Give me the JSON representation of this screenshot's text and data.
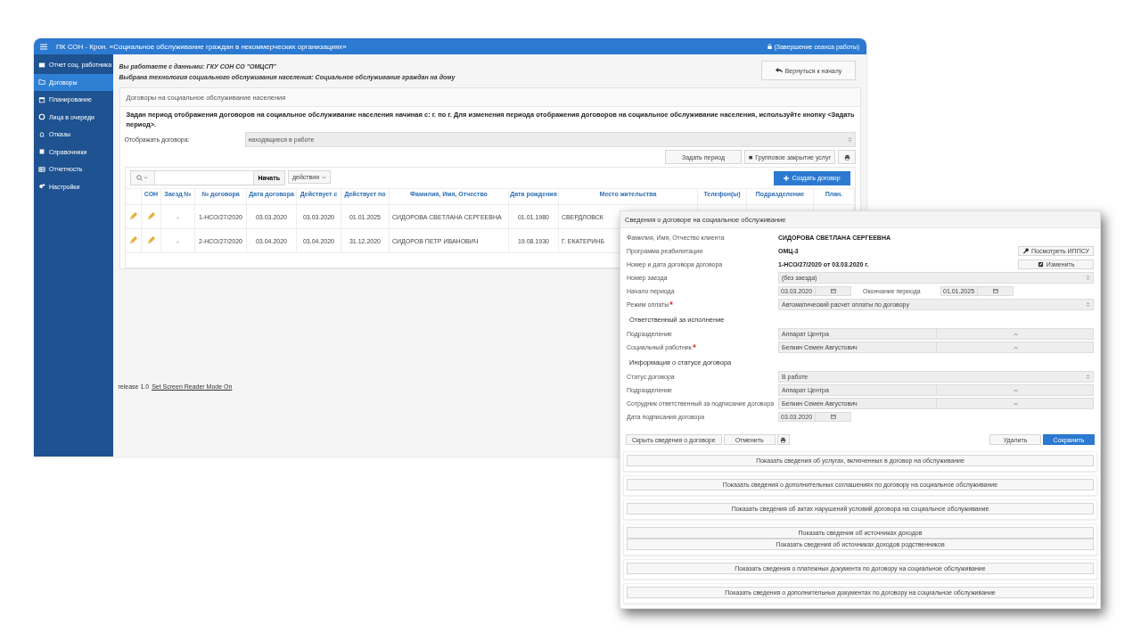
{
  "window": {
    "title": "ПК СОН - Крон. «Социальное обслуживание граждан в некоммерческих организациях»",
    "logout": "(Завершение сеанса работы)"
  },
  "sidebar": {
    "items": [
      {
        "label": "Отчет соц. работника",
        "selected": false
      },
      {
        "label": "Договоры",
        "selected": true
      },
      {
        "label": "Планирование",
        "selected": false
      },
      {
        "label": "Лица в очереди",
        "selected": false
      },
      {
        "label": "Отказы",
        "selected": false
      },
      {
        "label": "Справочники",
        "selected": false
      },
      {
        "label": "Отчетность",
        "selected": false
      },
      {
        "label": "Настройки",
        "selected": false
      }
    ]
  },
  "context": {
    "lines": [
      "Вы работаете с данными: ГКУ СОН СО \"ОМЦСП\"",
      "Выбрана технология социального обслуживания населения: Социальное обслуживание граждан на дому"
    ],
    "back_button": "Вернуться к началу"
  },
  "panel": {
    "title": "Договоры на социальное обслуживание населения",
    "notice": "Задан период отображения договоров на социальное обслуживание населения начиная с: г. по г. Для изменения периода отображения договоров на социальное обслуживание населения, используйте кнопку <Задать период>.",
    "filter": {
      "label": "Отображать договора:",
      "value": "находящиеся в работе"
    },
    "buttons": [
      "Задать период",
      "Групповое закрытие услуг"
    ],
    "search": {
      "go": "Начать",
      "actions": "действия"
    },
    "create_button": "Создать договор",
    "table": {
      "columns": [
        "",
        "СОН",
        "Заезд №",
        "№ договора",
        "Дата договора",
        "Действует с",
        "Действует по",
        "Фамилия, Имя, Отчество",
        "Дата рождения",
        "Место жительства",
        "Телефон(ы)",
        "Подразделение",
        "План."
      ],
      "rows": [
        {
          "cells": [
            "",
            "",
            "-",
            "1-НСО/27/2020",
            "03.03.2020",
            "03.03.2020",
            "01.01.2025",
            "СИДОРОВА СВЕТЛАНА СЕРГЕЕВНА",
            "01.01.1980",
            "СВЕРДЛОВСК"
          ]
        },
        {
          "cells": [
            "",
            "",
            "-",
            "2-НСО/27/2020",
            "03.04.2020",
            "03.04.2020",
            "31.12.2020",
            "СИДОРОВ ПЕТР ИВАНОВИЧ",
            "19.08.1930",
            "Г. ЕКАТЕРИНБ"
          ]
        }
      ]
    }
  },
  "footer": {
    "text": "release 1.0",
    "link": "Set Screen Reader Mode On"
  },
  "dialog": {
    "title": "Сведения о договоре на социальное обслуживание",
    "fields": [
      {
        "kind": "text",
        "label": "Фамилия, Имя, Отчество клиента",
        "value": "СИДОРОВА СВЕТЛАНА СЕРГЕЕВНА",
        "required": false
      },
      {
        "kind": "text",
        "label": "Программа реабилитации",
        "value": "ОМЦ-3",
        "required": false,
        "action": {
          "label": "Посмотреть ИППСУ",
          "kind": "view"
        }
      },
      {
        "kind": "text",
        "label": "Номер и дата договора договора",
        "value": "1-НСО/27/2020 от 03.03.2020 г.",
        "required": false,
        "action": {
          "label": "Изменить",
          "kind": "edit"
        }
      },
      {
        "kind": "select",
        "label": "Номер заезда",
        "value": "(без заезда)",
        "required": false
      },
      {
        "kind": "date_pair",
        "label": "Начало периода",
        "value": "03.03.2020",
        "label2": "Окончание периода",
        "value2": "01.01.2025",
        "required": false
      },
      {
        "kind": "select",
        "label": "Режим оплаты",
        "value": "Автоматический расчет оплаты по договору",
        "required": true
      },
      {
        "kind": "heading",
        "label": "Ответственный за исполнение",
        "required": false
      },
      {
        "kind": "combo",
        "label": "Подразделение",
        "value": "Аппарат Центра",
        "required": false
      },
      {
        "kind": "combo",
        "label": "Социальный работник",
        "value": "Белкин Семен Августович",
        "required": true
      },
      {
        "kind": "heading",
        "label": "Информация о статусе договора",
        "required": false
      },
      {
        "kind": "select",
        "label": "Статус договора",
        "value": "В работе",
        "required": false
      },
      {
        "kind": "combo",
        "label": "Подразделение",
        "value": "Аппарат Центра",
        "required": false
      },
      {
        "kind": "combo",
        "label": "Сотрудник ответственный за подписание договора",
        "value": "Белкин Семен Августович",
        "required": false
      },
      {
        "kind": "date",
        "label": "Дата подписания договора",
        "value": "03.03.2020",
        "required": false
      }
    ],
    "left_buttons": [
      "Скрыть сведения о договоре",
      "Отменить"
    ],
    "right_buttons": [
      {
        "label": "Удалить",
        "primary": false
      },
      {
        "label": "Сохранить",
        "primary": true
      }
    ],
    "sections": [
      {
        "buttons": [
          "Показать сведения об услугах, включенных в договор на обслуживание"
        ]
      },
      {
        "buttons": [
          "Показать сведения о дополнительных соглашениях по договору на социальное обслуживание"
        ]
      },
      {
        "buttons": [
          "Показать сведения об актах нарушений условий договора на социальное обслуживание"
        ]
      },
      {
        "buttons": [
          "Показать сведения об источниках доходов",
          "Показать сведения об источниках доходов родственников"
        ]
      },
      {
        "buttons": [
          "Показать сведения о платежных документа по договору на социальное обслуживание"
        ]
      },
      {
        "buttons": [
          "Показать сведения о дополнительных документах по договору на социальное обслуживание"
        ]
      }
    ]
  }
}
